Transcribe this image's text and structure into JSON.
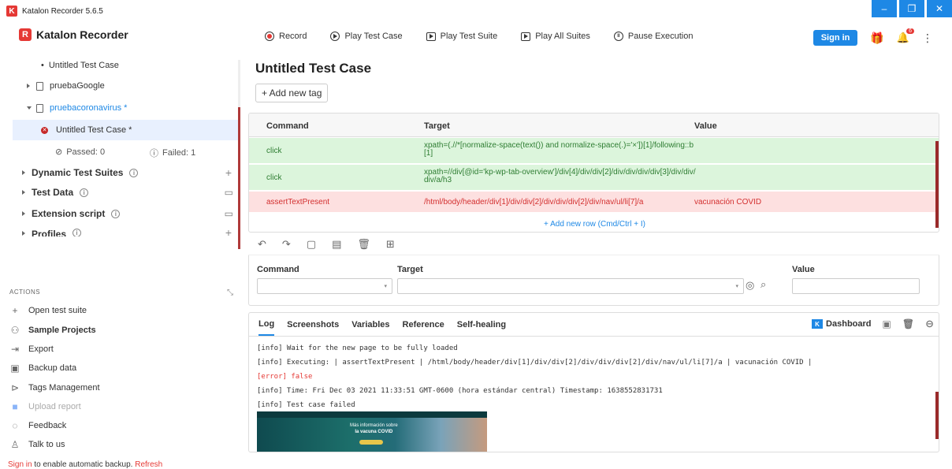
{
  "window": {
    "title": "Katalon Recorder 5.6.5"
  },
  "app": {
    "brand": "Katalon Recorder"
  },
  "toolbar": {
    "record": "Record",
    "play_case": "Play Test Case",
    "play_suite": "Play Test Suite",
    "play_all": "Play All Suites",
    "pause": "Pause Execution",
    "sign_in": "Sign in",
    "notification_count": "6"
  },
  "sidebar": {
    "tree": {
      "untitled_top": "Untitled Test Case",
      "suite1": "pruebaGoogle",
      "suite2": "pruebacoronavirus *",
      "case_selected": "Untitled Test Case *",
      "passed": "Passed: 0",
      "failed": "Failed: 1"
    },
    "sections": {
      "dynamic": "Dynamic Test Suites",
      "testdata": "Test Data",
      "extension": "Extension script",
      "profiles": "Profiles"
    },
    "actions_header": "ACTIONS",
    "actions": {
      "open": "Open test suite",
      "samples": "Sample Projects",
      "export": "Export",
      "backup": "Backup data",
      "tags": "Tags Management",
      "upload": "Upload report",
      "feedback": "Feedback",
      "talk": "Talk to us"
    },
    "footer": {
      "sign_in": "Sign in",
      "text": " to enable automatic backup. ",
      "refresh": "Refresh"
    }
  },
  "main": {
    "title": "Untitled Test Case",
    "add_tag": "+ Add new tag",
    "table": {
      "headers": {
        "command": "Command",
        "target": "Target",
        "value": "Value"
      },
      "rows": [
        {
          "command": "click",
          "target": "xpath=(.//*[normalize-space(text()) and normalize-space(.)='×'])[1]/following::b[1]",
          "value": ""
        },
        {
          "command": "click",
          "target": "xpath=//div[@id='kp-wp-tab-overview']/div[4]/div/div[2]/div/div/div/div[3]/div/div/div/a/h3",
          "value": ""
        },
        {
          "command": "assertTextPresent",
          "target": "/html/body/header/div[1]/div/div[2]/div/div/div[2]/div/nav/ul/li[7]/a",
          "value": "vacunación COVID"
        }
      ],
      "add_row": "+ Add new row (Cmd/Ctrl + I)"
    },
    "editor": {
      "command_label": "Command",
      "target_label": "Target",
      "value_label": "Value"
    },
    "log": {
      "tabs": [
        "Log",
        "Screenshots",
        "Variables",
        "Reference",
        "Self-healing"
      ],
      "dashboard": "Dashboard",
      "lines": [
        "[info] Wait for the new page to be fully loaded",
        "[info] Executing: | assertTextPresent | /html/body/header/div[1]/div/div[2]/div/div/div[2]/div/nav/ul/li[7]/a | vacunación COVID |",
        "[error] false",
        "[info] Time: Fri Dec 03 2021 11:33:51 GMT-0600 (hora estándar central) Timestamp: 1638552831731",
        "[info] Test case failed"
      ],
      "thumb_text1": "Más información sobre",
      "thumb_text2": "la vacuna COVID"
    }
  }
}
